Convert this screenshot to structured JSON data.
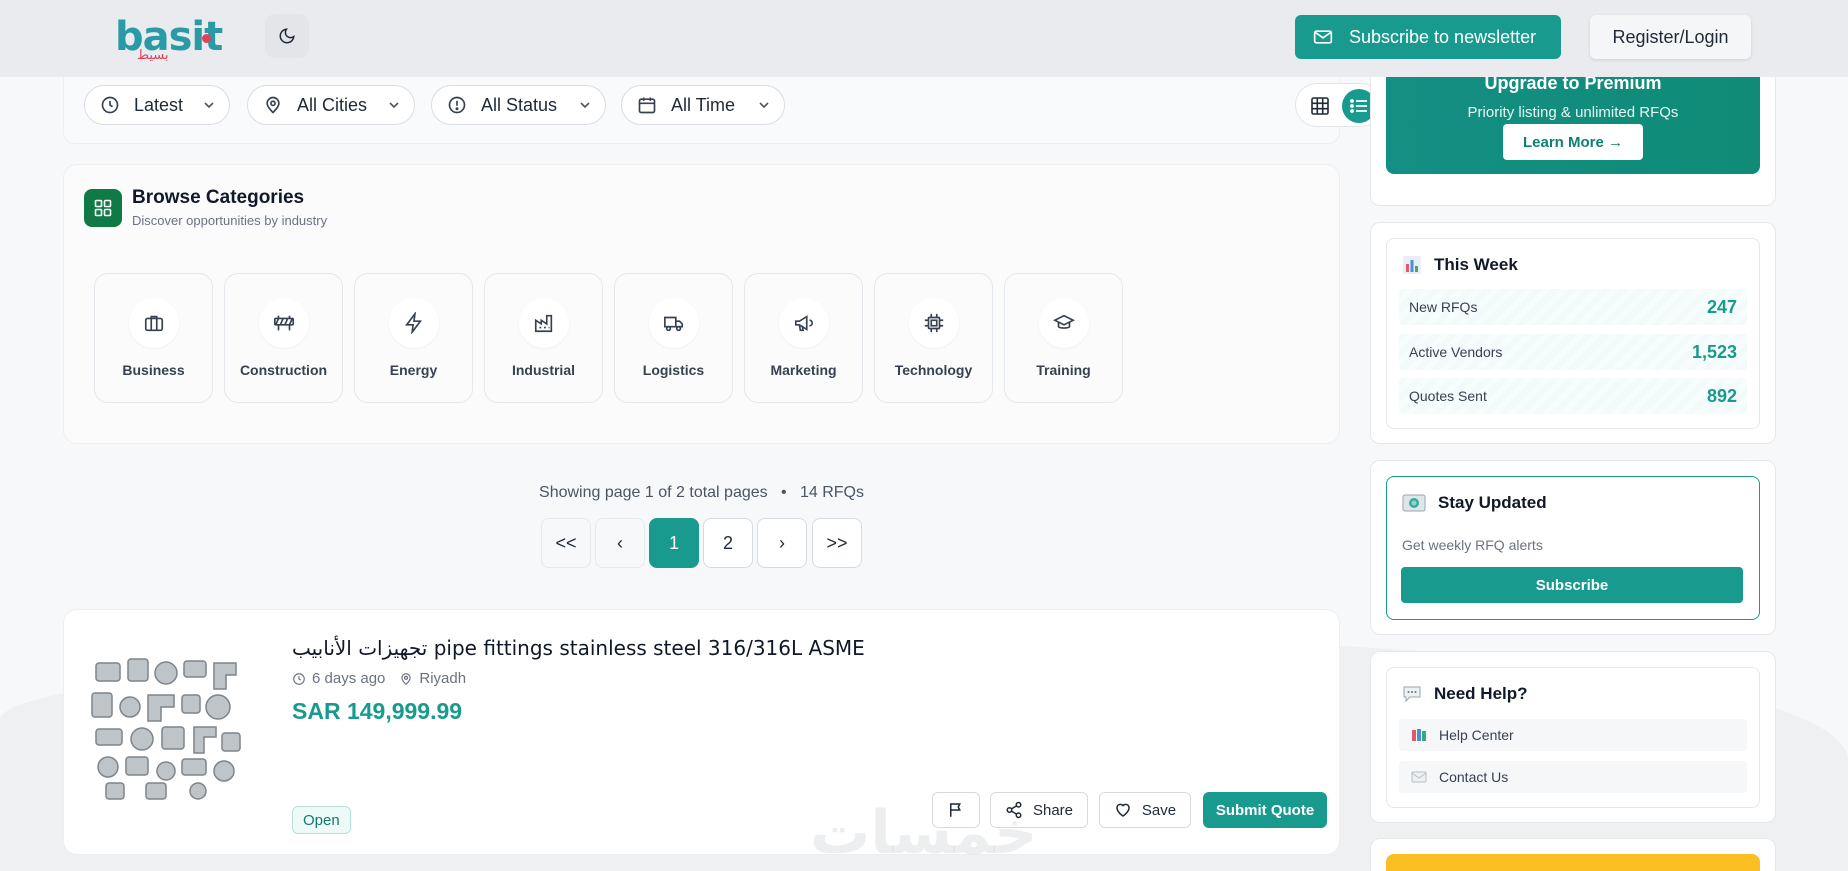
{
  "header": {
    "logo_text": "basit",
    "logo_arabic": "بسيط",
    "subscribe_label": "Subscribe to newsletter",
    "login_label": "Register/Login"
  },
  "filters": [
    {
      "label": "Latest",
      "icon": "clock-icon"
    },
    {
      "label": "All Cities",
      "icon": "map-pin-icon"
    },
    {
      "label": "All Status",
      "icon": "alert-circle-icon"
    },
    {
      "label": "All Time",
      "icon": "calendar-icon"
    }
  ],
  "view_toggle": {
    "active": "list"
  },
  "categories": {
    "title": "Browse Categories",
    "subtitle": "Discover opportunities by industry",
    "items": [
      {
        "label": "Business",
        "icon": "briefcase-icon"
      },
      {
        "label": "Construction",
        "icon": "barrier-icon"
      },
      {
        "label": "Energy",
        "icon": "lightning-icon"
      },
      {
        "label": "Industrial",
        "icon": "factory-icon"
      },
      {
        "label": "Logistics",
        "icon": "truck-icon"
      },
      {
        "label": "Marketing",
        "icon": "megaphone-icon"
      },
      {
        "label": "Technology",
        "icon": "chip-icon"
      },
      {
        "label": "Training",
        "icon": "graduation-cap-icon"
      }
    ]
  },
  "pagination": {
    "info": "Showing page 1 of 2 total pages",
    "separator": "•",
    "count": "14 RFQs",
    "first": "<<",
    "prev": "‹",
    "pages": [
      "1",
      "2"
    ],
    "current": "1",
    "next": "›",
    "last": ">>"
  },
  "rfq": {
    "title": "تجهيزات الأنابيب pipe fittings stainless steel 316/316L ASME",
    "time": "6 days ago",
    "city": "Riyadh",
    "price": "SAR 149,999.99",
    "status": "Open",
    "share_label": "Share",
    "save_label": "Save",
    "submit_label": "Submit Quote"
  },
  "watermark": "خمسات",
  "sidebar": {
    "premium": {
      "title": "Upgrade to Premium",
      "subtitle": "Priority listing & unlimited RFQs",
      "button": "Learn More →"
    },
    "this_week": {
      "title": "This Week",
      "stats": [
        {
          "label": "New RFQs",
          "value": "247"
        },
        {
          "label": "Active Vendors",
          "value": "1,523"
        },
        {
          "label": "Quotes Sent",
          "value": "892"
        }
      ]
    },
    "stay_updated": {
      "title": "Stay Updated",
      "subtitle": "Get weekly RFQ alerts",
      "button": "Subscribe"
    },
    "need_help": {
      "title": "Need Help?",
      "links": [
        {
          "label": "Help Center",
          "icon": "books-icon"
        },
        {
          "label": "Contact Us",
          "icon": "envelope-icon"
        }
      ]
    }
  },
  "colors": {
    "primary": "#199a8e",
    "category_icon_bg": "#0f7a45",
    "accent_red": "#e0425b",
    "yellow": "#fbbf24"
  }
}
